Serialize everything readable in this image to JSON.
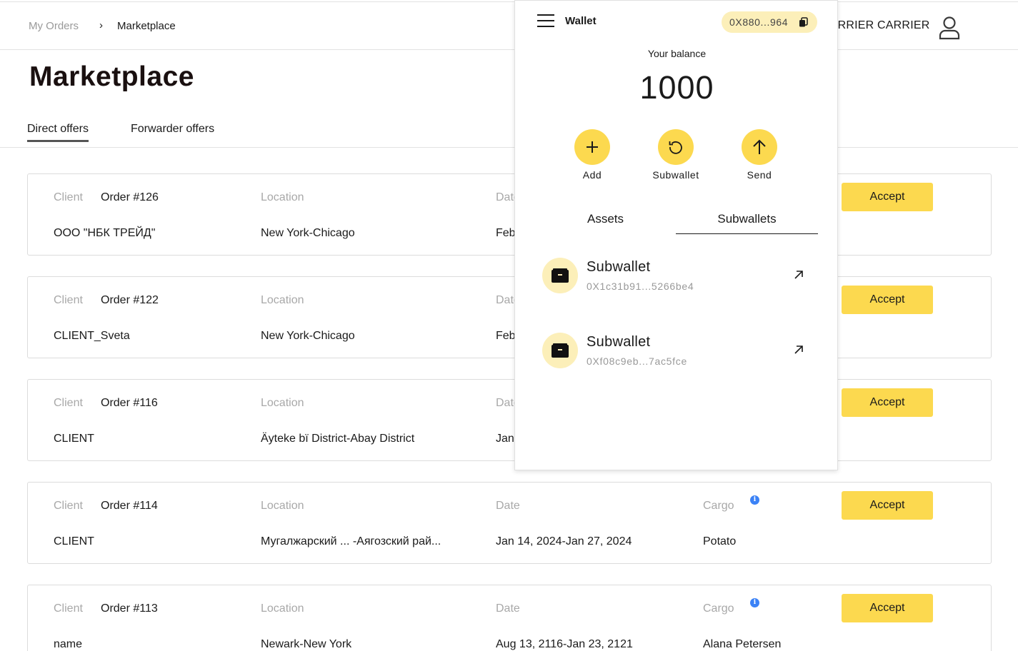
{
  "breadcrumb": {
    "root": "My Orders",
    "separator": "›",
    "current": "Marketplace"
  },
  "user": {
    "name": "CARRIER CARRIER"
  },
  "page": {
    "title": "Marketplace"
  },
  "tabs": [
    {
      "label": "Direct offers",
      "active": true
    },
    {
      "label": "Forwarder offers",
      "active": false
    }
  ],
  "labels": {
    "client": "Client",
    "location": "Location",
    "date": "Date",
    "cargo": "Cargo",
    "accept": "Accept",
    "info": "i"
  },
  "orders": [
    {
      "order": "Order #126",
      "client": "ООО \"НБК ТРЕЙД\"",
      "location": "New York-Chicago",
      "date": "Feb",
      "cargo": ""
    },
    {
      "order": "Order #122",
      "client": "CLIENT_Sveta",
      "location": "New York-Chicago",
      "date": "Feb",
      "cargo": ""
    },
    {
      "order": "Order #116",
      "client": "CLIENT",
      "location": "Äyteke bï District-Abay District",
      "date": "Jan",
      "cargo": ""
    },
    {
      "order": "Order #114",
      "client": "CLIENT",
      "location": "Мугалжарский ... -Аягозский рай...",
      "date": "Jan 14, 2024-Jan 27, 2024",
      "cargo": "Potato"
    },
    {
      "order": "Order #113",
      "client": "name",
      "location": "Newark-New York",
      "date": "Aug 13, 2116-Jan 23, 2121",
      "cargo": "Alana Petersen"
    }
  ],
  "wallet": {
    "title": "Wallet",
    "address_short": "0X880...964",
    "balance_label": "Your balance",
    "balance": "1000",
    "actions": [
      {
        "label": "Add",
        "icon": "plus-icon"
      },
      {
        "label": "Subwallet",
        "icon": "refresh-icon"
      },
      {
        "label": "Send",
        "icon": "arrow-up-icon"
      }
    ],
    "tabs": [
      {
        "label": "Assets",
        "active": false
      },
      {
        "label": "Subwallets",
        "active": true
      }
    ],
    "subwallets": [
      {
        "name": "Subwallet",
        "address": "0X1c31b91...5266be4"
      },
      {
        "name": "Subwallet",
        "address": "0Xf08c9eb...7ac5fce"
      }
    ],
    "accent": "#fcd94f",
    "accent_light": "#fcefb9"
  },
  "colors": {
    "accept_button": "#fcd94f",
    "info_icon": "#3b82f6",
    "muted_label": "#a8a8a8"
  }
}
